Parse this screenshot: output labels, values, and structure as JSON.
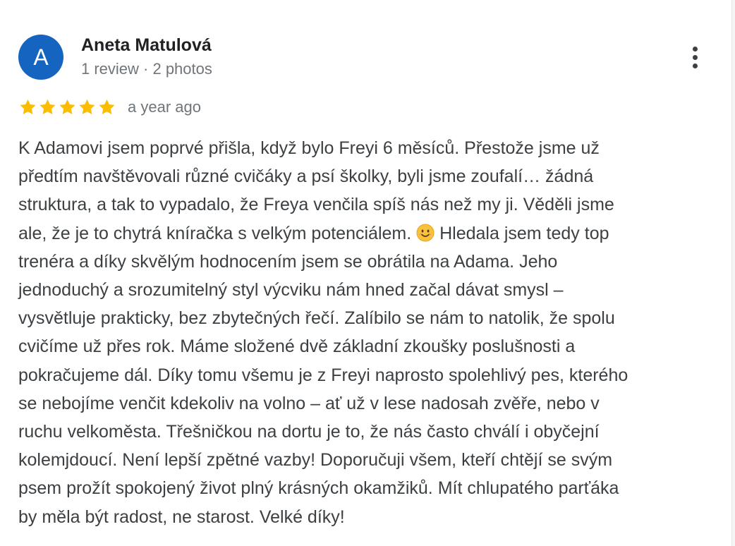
{
  "reviewer": {
    "avatar_initial": "A",
    "name": "Aneta Matulová",
    "meta": "1 review · 2 photos"
  },
  "rating": {
    "stars": 5,
    "max_stars": 5,
    "time_ago": "a year ago"
  },
  "menu": {
    "icon": "more-vert-icon"
  },
  "review": {
    "line1": "K Adamovi jsem poprvé přišla, když bylo Freyi 6 měsíců. Přestože jsme už",
    "line2": "předtím navštěvovali různé cvičáky a psí školky, byli jsme zoufalí… žádná",
    "line3": "struktura, a tak to vypadalo, že Freya venčila spíš nás než my ji. Věděli jsme",
    "line4a": "ale, že je to chytrá kníračka s velkým potenciálem.",
    "line4_emoji": "smiling-face-emoji",
    "line4b": "Hledala jsem tedy top",
    "line5": "trenéra a díky skvělým hodnocením jsem se obrátila na Adama. Jeho",
    "line6": "jednoduchý a srozumitelný styl výcviku nám hned začal dávat smysl –",
    "line7": "vysvětluje prakticky, bez zbytečných řečí. Zalíbilo se nám to natolik, že spolu",
    "line8": "cvičíme už přes rok. Máme složené dvě základní zkoušky poslušnosti a",
    "line9": "pokračujeme dál. Díky tomu všemu je z Freyi naprosto spolehlivý pes, kterého",
    "line10": "se nebojíme venčit kdekoliv na volno – ať už v lese nadosah zvěře, nebo v",
    "line11": "ruchu velkoměsta. Třešničkou na dortu je to, že nás často chválí i obyčejní",
    "line12": "kolemjdoucí. Není lepší zpětné vazby! Doporučuji všem, kteří chtějí se svým",
    "line13": "psem prožít spokojený život plný krásných okamžiků. Mít chlupatého parťáka",
    "line14": "by měla být radost, ne starost. Velké díky!"
  },
  "colors": {
    "avatar_bg": "#1565c0",
    "star": "#fbbc04",
    "text": "#3c4043",
    "secondary": "#70757a"
  }
}
